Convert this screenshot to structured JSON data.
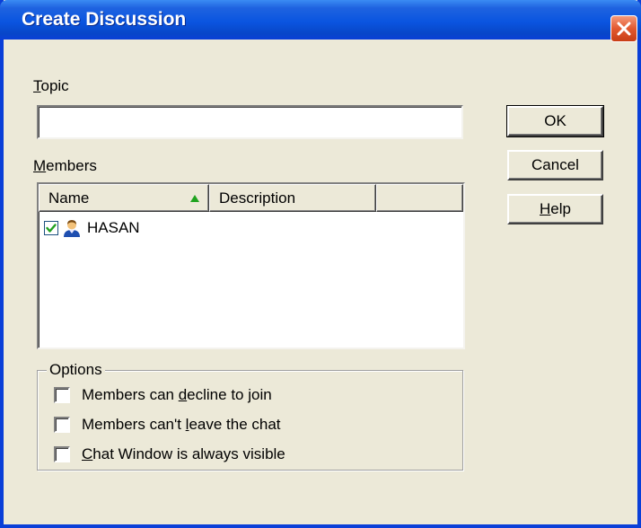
{
  "window": {
    "title": "Create Discussion"
  },
  "topic": {
    "label_first": "T",
    "label_rest": "opic",
    "value": "",
    "placeholder": ""
  },
  "members": {
    "label_first": "M",
    "label_rest": "embers",
    "columns": [
      "Name",
      "Description"
    ],
    "sort_indicator": "sort-ascending-icon",
    "rows": [
      {
        "checked": true,
        "icon": "user-icon",
        "name": "HASAN",
        "description": ""
      }
    ]
  },
  "options": {
    "legend": "Options",
    "items": [
      {
        "before": "Members can ",
        "accel": "d",
        "after": "ecline to join",
        "checked": false
      },
      {
        "before": "Members can't ",
        "accel": "l",
        "after": "eave the chat",
        "checked": false
      },
      {
        "before": "",
        "accel": "C",
        "after": "hat Window is always visible",
        "checked": false
      }
    ]
  },
  "buttons": {
    "ok": "OK",
    "cancel": "Cancel",
    "help_accel": "H",
    "help_rest": "elp"
  },
  "colors": {
    "titlebar": "#0a55e0",
    "dialog_bg": "#ece9d8",
    "close_button": "#e2582f",
    "sort_arrow": "#1fa31f"
  }
}
